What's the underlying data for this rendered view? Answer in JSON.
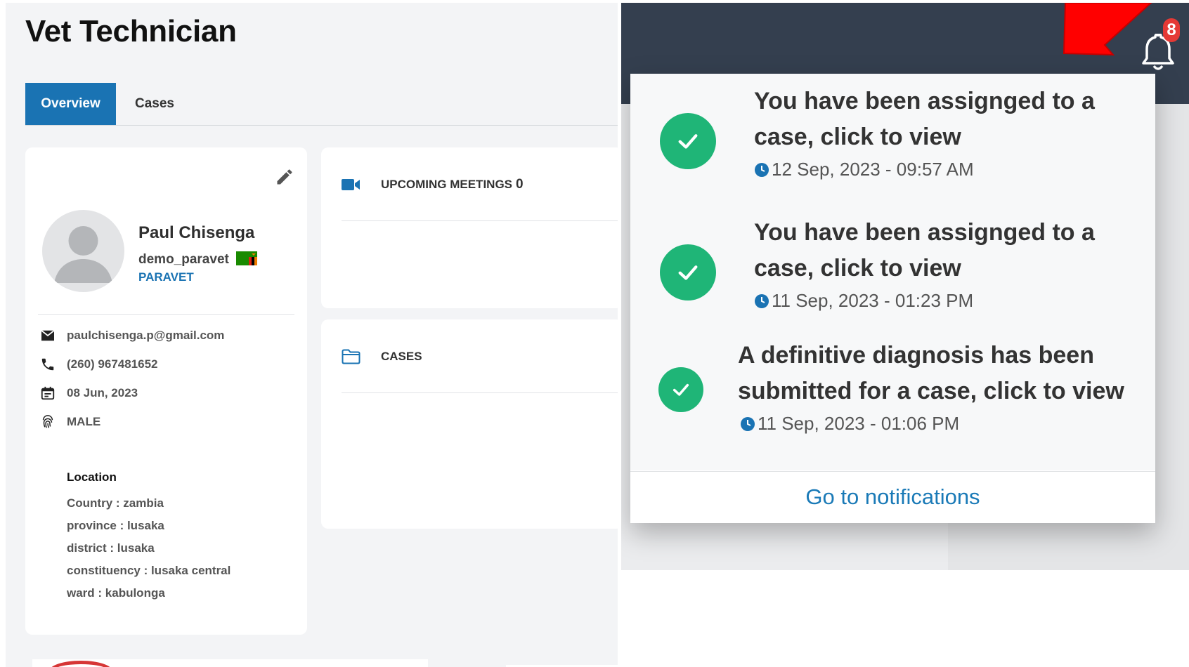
{
  "page": {
    "title": "Vet Technician",
    "tabs": [
      {
        "label": "Overview",
        "active": true
      },
      {
        "label": "Cases",
        "active": false
      }
    ]
  },
  "profile": {
    "name": "Paul Chisenga",
    "username": "demo_paravet",
    "role": "PARAVET",
    "email": "paulchisenga.p@gmail.com",
    "phone": "(260) 967481652",
    "date": "08 Jun, 2023",
    "gender": "MALE",
    "location": {
      "title": "Location",
      "items": [
        "Country : zambia",
        "province : lusaka",
        "district : lusaka",
        "constituency : lusaka central",
        "ward : kabulonga"
      ]
    }
  },
  "meetings": {
    "label": "UPCOMING MEETINGS",
    "count": "0"
  },
  "cases": {
    "label": "CASES"
  },
  "notifications": {
    "badge_count": "8",
    "items": [
      {
        "line1": "You have been assignged to a",
        "line2": "case, click to view",
        "time": "12 Sep, 2023 - 09:57 AM"
      },
      {
        "line1": "You have been assignged to a",
        "line2": "case, click to view",
        "time": "11 Sep, 2023 - 01:23 PM"
      },
      {
        "line1": "A definitive diagnosis has been",
        "line2": "submitted for a case, click to view",
        "time": "11 Sep, 2023 - 01:06 PM"
      }
    ],
    "footer_link": "Go to notifications"
  },
  "colors": {
    "primary": "#1a73b3",
    "topbar": "#343f4f",
    "success": "#1fb577",
    "badge": "#e53935",
    "annotation_arrow": "#ff0000"
  }
}
